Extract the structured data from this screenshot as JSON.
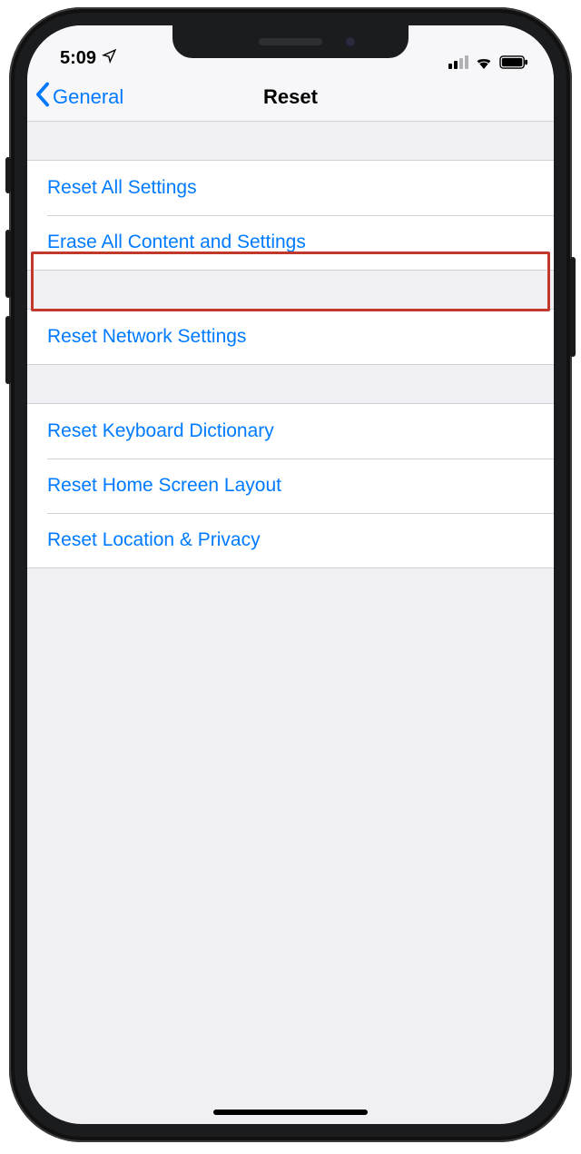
{
  "status": {
    "time": "5:09"
  },
  "nav": {
    "back_label": "General",
    "title": "Reset"
  },
  "groups": [
    {
      "rows": [
        {
          "label": "Reset All Settings",
          "name": "reset-all-settings"
        },
        {
          "label": "Erase All Content and Settings",
          "name": "erase-all-content",
          "highlighted": true
        }
      ]
    },
    {
      "rows": [
        {
          "label": "Reset Network Settings",
          "name": "reset-network-settings"
        }
      ]
    },
    {
      "rows": [
        {
          "label": "Reset Keyboard Dictionary",
          "name": "reset-keyboard-dictionary"
        },
        {
          "label": "Reset Home Screen Layout",
          "name": "reset-home-screen-layout"
        },
        {
          "label": "Reset Location & Privacy",
          "name": "reset-location-privacy"
        }
      ]
    }
  ]
}
